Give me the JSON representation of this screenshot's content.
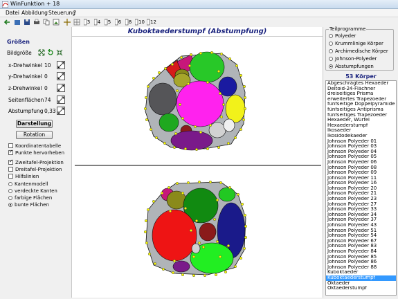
{
  "window": {
    "title": "WinFunktion + 18"
  },
  "menu": [
    "Datei",
    "Abbildung",
    "Steuerung",
    "?"
  ],
  "toolbar": {
    "numbers": [
      "3",
      "4",
      "5",
      "6",
      "8",
      "10",
      "12"
    ]
  },
  "heading": "Kuboktaederstumpf (Abstumpfung)",
  "left": {
    "section_title": "Größen",
    "bildgroesse_label": "Bildgröße",
    "rows": [
      {
        "label": "x-Drehwinkel",
        "value": "10"
      },
      {
        "label": "y-Drehwinkel",
        "value": "0"
      },
      {
        "label": "z-Drehwinkel",
        "value": "0"
      },
      {
        "label": "Seitenflächen",
        "value": "74"
      },
      {
        "label": "Abstumpfung",
        "value": "0,33"
      }
    ],
    "buttons": {
      "darstellung": "Darstellung",
      "rotation": "Rotation"
    },
    "checks_a": [
      {
        "label": "Koordinatentabelle",
        "checked": false
      },
      {
        "label": "Punkte hervorheben",
        "checked": true
      }
    ],
    "checks_b": [
      {
        "label": "Zweitafel-Projektion",
        "checked": true
      },
      {
        "label": "Dreitafel-Projektion",
        "checked": false
      },
      {
        "label": "Hilfslinien",
        "checked": false
      }
    ],
    "radios": [
      {
        "label": "Kantenmodell",
        "checked": false
      },
      {
        "label": "verdeckte Kanten",
        "checked": false
      },
      {
        "label": "farbige Flächen",
        "checked": false
      },
      {
        "label": "bunte Flächen",
        "checked": true
      }
    ]
  },
  "right": {
    "group_title": "Teilprogramme",
    "programs": [
      {
        "label": "Polyeder",
        "checked": false
      },
      {
        "label": "Krummlinige Körper",
        "checked": false
      },
      {
        "label": "Archimedische Körper",
        "checked": false
      },
      {
        "label": "Johnson-Polyeder",
        "checked": false
      },
      {
        "label": "Abstumpfungen",
        "checked": true
      }
    ],
    "count_label": "53 Körper",
    "items": [
      "Abgeschrägtes Hexaeder",
      "Deltoid-24-Flächner",
      "dreiseitiges Prisma",
      "erweitertes Trapezoeder",
      "fünfseitige Doppelpyramide",
      "fünfseitiges Antiprisma",
      "fünfseitiges Trapezoeder",
      "Hexaeder, Würfel",
      "Hexaederstumpf",
      "Ikosaeder",
      "Ikosidodekaeder",
      "Johnson Polyeder 01",
      "Johnson Polyeder 03",
      "Johnson Polyeder 04",
      "Johnson Polyeder 05",
      "Johnson Polyeder 06",
      "Johnson Polyeder 08",
      "Johnson Polyeder 09",
      "Johnson Polyeder 11",
      "Johnson Polyeder 16",
      "Johnson Polyeder 20",
      "Johnson Polyeder 21",
      "Johnson Polyeder 23",
      "Johnson Polyeder 27",
      "Johnson Polyeder 33",
      "Johnson Polyeder 34",
      "Johnson Polyeder 37",
      "Johnson Polyeder 43",
      "Johnson Polyeder 51",
      "Johnson Polyeder 54",
      "Johnson Polyeder 67",
      "Johnson Polyeder 83",
      "Johnson Polyeder 84",
      "Johnson Polyeder 85",
      "Johnson Polyeder 86",
      "Johnson Polyeder 88",
      "Kuboktaeder",
      "Kuboktaederstumpf",
      "Oktaeder",
      "Oktaederstumpf"
    ],
    "selected": "Kuboktaederstumpf"
  },
  "colors": {
    "accent": "#1a237e",
    "selection": "#3399ff"
  }
}
